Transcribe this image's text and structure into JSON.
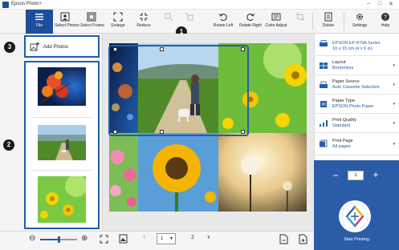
{
  "window": {
    "title": "Epson Photo+",
    "minimize_glyph": "–",
    "maximize_glyph": "□",
    "close_glyph": "✕"
  },
  "toolbar": {
    "file": "File",
    "select_photos": "Select Photos",
    "select_frame": "Select Frame",
    "enlarge": "Enlarge",
    "reduce": "Reduce",
    "rotate_left": "Rotate Left",
    "rotate_right": "Rotate Right",
    "color_adjust": "Color Adjust",
    "delete": "Delete",
    "settings": "Settings",
    "help": "Help"
  },
  "left_panel": {
    "add_photos": "Add Photos"
  },
  "callouts": {
    "one": "1",
    "two": "2",
    "three": "3"
  },
  "bottom_bar": {
    "zoom_out_glyph": "⊖",
    "zoom_in_glyph": "⊕",
    "zoom_level": 0.5,
    "prev_glyph": "‹",
    "next_glyph": "›",
    "current_page": "1",
    "page_dropdown_glyph": "▾",
    "total_pages": "2"
  },
  "right_panel": {
    "printer_name": "EPSON EP-879A Series",
    "paper_size": "10 x 15 cm (4 x 6 in)",
    "layout_label": "Layout",
    "layout_value": "Borderless",
    "paper_source_label": "Paper Source",
    "paper_source_value": "Auto Cassette Selection",
    "paper_type_label": "Paper Type",
    "paper_type_value": "EPSON Photo Paper",
    "print_quality_label": "Print Quality",
    "print_quality_value": "Standard",
    "print_page_label": "Print Page",
    "print_page_value": "All pages",
    "dropdown_glyph": "▾",
    "minus_glyph": "−",
    "plus_glyph": "+",
    "copies": "1",
    "start_printing": "Start Printing"
  },
  "colors": {
    "accent": "#1f5fa8",
    "file_tab": "#1f4e9c",
    "print_panel": "#2b5ca8"
  }
}
